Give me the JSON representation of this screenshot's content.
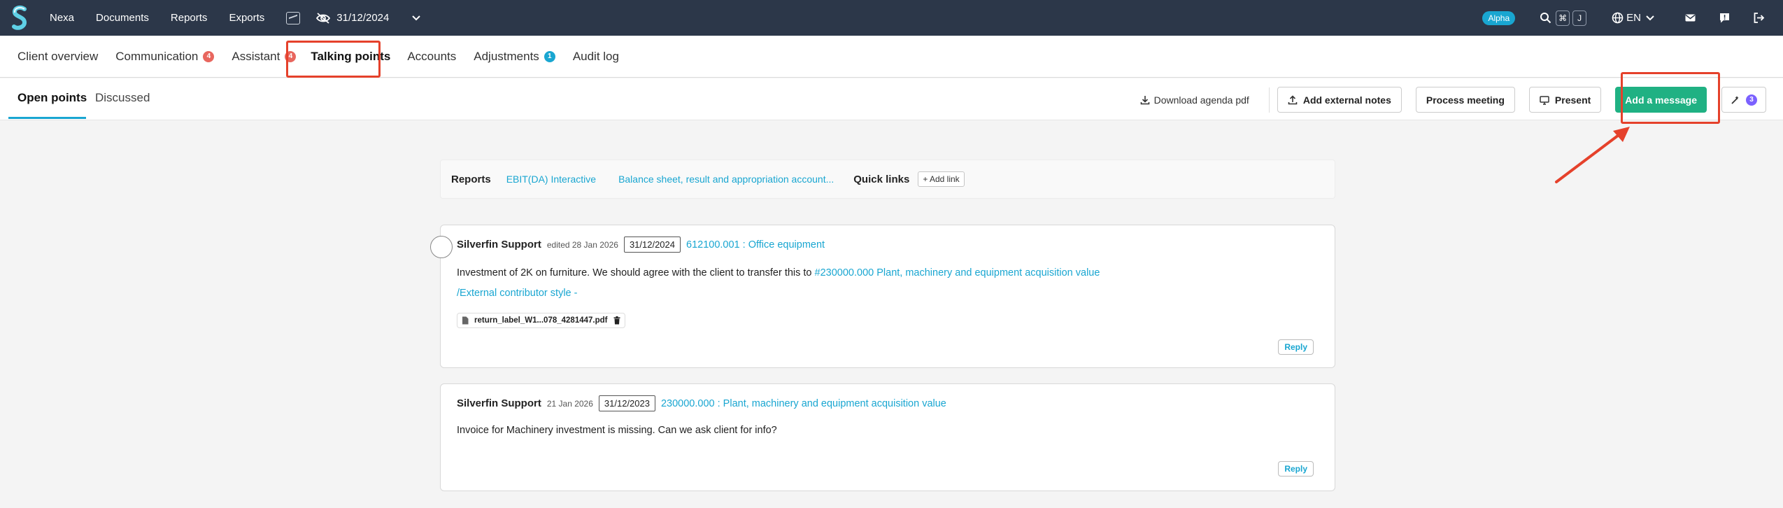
{
  "topbar": {
    "nav": [
      "Nexa",
      "Documents",
      "Reports",
      "Exports"
    ],
    "date": "31/12/2024",
    "alpha_label": "Alpha",
    "kbd_cmd": "⌘",
    "kbd_key": "J",
    "lang": "EN",
    "icons": [
      "silverfin-logo",
      "image-icon",
      "eye-off-icon",
      "chevron-down-icon",
      "search-icon",
      "globe-icon",
      "mail-icon",
      "feedback-icon",
      "logout-icon"
    ]
  },
  "tabs": [
    {
      "label": "Client overview"
    },
    {
      "label": "Communication",
      "badge": "4"
    },
    {
      "label": "Assistant",
      "badge": "4"
    },
    {
      "label": "Talking points"
    },
    {
      "label": "Accounts"
    },
    {
      "label": "Adjustments",
      "badge": "1"
    },
    {
      "label": "Audit log"
    }
  ],
  "subtabs": {
    "open": "Open points",
    "discussed": "Discussed"
  },
  "actions": {
    "download": "Download agenda pdf",
    "external_notes": "Add external notes",
    "process": "Process meeting",
    "present": "Present",
    "add_message": "Add a message",
    "ai_badge": "3"
  },
  "reports_bar": {
    "reports_label": "Reports",
    "link1": "EBIT(DA) Interactive",
    "link2": "Balance sheet, result and appropriation account...",
    "quick_label": "Quick links",
    "add_link": "+ Add link"
  },
  "messages": [
    {
      "author": "Silverfin Support",
      "meta": "edited 28 Jan 2026",
      "date": "31/12/2024",
      "account": "612100.001 : Office equipment",
      "text": "Investment of 2K on furniture. We should agree with the client to transfer this to ",
      "text_link": "#230000.000 Plant, machinery and equipment acquisition value",
      "text_link2": "/External contributor style -",
      "file": "return_label_W1...078_4281447.pdf",
      "reply": "Reply"
    },
    {
      "author": "Silverfin Support",
      "meta": "21 Jan 2026",
      "date": "31/12/2023",
      "account": "230000.000 : Plant, machinery and equipment acquisition value",
      "text": "Invoice for Machinery investment is missing. Can we ask client for info?",
      "reply": "Reply"
    }
  ],
  "colors": {
    "topbar": "#2c3749",
    "accent": "#19a6d1",
    "primary": "#20b183",
    "highlight": "#e5412b"
  }
}
